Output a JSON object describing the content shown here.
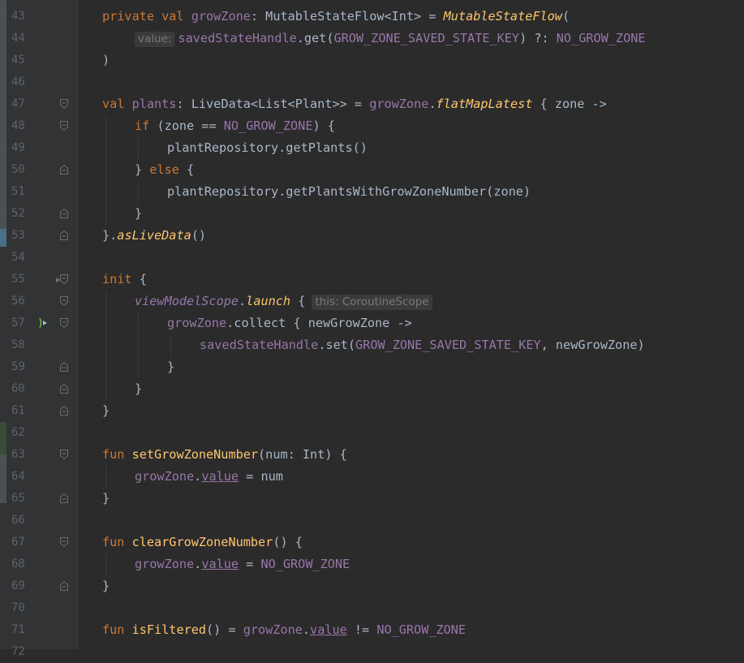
{
  "editor": {
    "language": "kotlin",
    "first_line": 43,
    "lines": [
      {
        "num": "43",
        "indent": 0,
        "tokens": [
          {
            "t": "private val ",
            "c": "kw"
          },
          {
            "t": "growZone",
            "c": "prop"
          },
          {
            "t": ": MutableStateFlow<Int> = ",
            "c": ""
          },
          {
            "t": "MutableStateFlow",
            "c": "top-fn"
          },
          {
            "t": "(",
            "c": ""
          }
        ],
        "fold": "none"
      },
      {
        "num": "44",
        "indent": 1,
        "tokens": [
          {
            "t": "value:",
            "c": "hint"
          },
          {
            "t": "savedStateHandle",
            "c": "prop"
          },
          {
            "t": ".get(",
            "c": ""
          },
          {
            "t": "GROW_ZONE_SAVED_STATE_KEY",
            "c": "prop"
          },
          {
            "t": ") ?: ",
            "c": ""
          },
          {
            "t": "NO_GROW_ZONE",
            "c": "prop"
          }
        ],
        "fold": "none"
      },
      {
        "num": "45",
        "indent": 0,
        "tokens": [
          {
            "t": ")",
            "c": ""
          }
        ],
        "fold": "none"
      },
      {
        "num": "46",
        "indent": 0,
        "tokens": [],
        "fold": "none"
      },
      {
        "num": "47",
        "indent": 0,
        "tokens": [
          {
            "t": "val ",
            "c": "kw"
          },
          {
            "t": "plants",
            "c": "prop"
          },
          {
            "t": ": LiveData<List<Plant>> = ",
            "c": ""
          },
          {
            "t": "growZone",
            "c": "prop"
          },
          {
            "t": ".",
            "c": ""
          },
          {
            "t": "flatMapLatest",
            "c": "ext"
          },
          {
            "t": " { zone ->",
            "c": ""
          }
        ],
        "fold": "open"
      },
      {
        "num": "48",
        "indent": 1,
        "tokens": [
          {
            "t": "if ",
            "c": "kw"
          },
          {
            "t": "(zone == ",
            "c": ""
          },
          {
            "t": "NO_GROW_ZONE",
            "c": "prop"
          },
          {
            "t": ") {",
            "c": ""
          }
        ],
        "fold": "open"
      },
      {
        "num": "49",
        "indent": 2,
        "tokens": [
          {
            "t": "plantRepository.getPlants()",
            "c": ""
          }
        ],
        "fold": "none"
      },
      {
        "num": "50",
        "indent": 1,
        "tokens": [
          {
            "t": "} ",
            "c": ""
          },
          {
            "t": "else ",
            "c": "kw"
          },
          {
            "t": "{",
            "c": ""
          }
        ],
        "fold": "close"
      },
      {
        "num": "51",
        "indent": 2,
        "tokens": [
          {
            "t": "plantRepository.getPlantsWithGrowZoneNumber(zone)",
            "c": ""
          }
        ],
        "fold": "none"
      },
      {
        "num": "52",
        "indent": 1,
        "tokens": [
          {
            "t": "}",
            "c": ""
          }
        ],
        "fold": "close"
      },
      {
        "num": "53",
        "indent": 0,
        "tokens": [
          {
            "t": "}.",
            "c": ""
          },
          {
            "t": "asLiveData",
            "c": "ext"
          },
          {
            "t": "()",
            "c": ""
          }
        ],
        "fold": "close"
      },
      {
        "num": "54",
        "indent": 0,
        "tokens": [],
        "fold": "none"
      },
      {
        "num": "55",
        "indent": 0,
        "tokens": [
          {
            "t": "init ",
            "c": "kw"
          },
          {
            "t": "{",
            "c": ""
          }
        ],
        "fold": "open"
      },
      {
        "num": "56",
        "indent": 1,
        "tokens": [
          {
            "t": "viewModelScope",
            "c": "prop ital"
          },
          {
            "t": ".",
            "c": ""
          },
          {
            "t": "launch",
            "c": "ext"
          },
          {
            "t": " {",
            "c": ""
          },
          {
            "t": "this: CoroutineScope",
            "c": "hint hint-after"
          }
        ],
        "fold": "open"
      },
      {
        "num": "57",
        "indent": 2,
        "tokens": [
          {
            "t": "growZone",
            "c": "prop"
          },
          {
            "t": ".collect { newGrowZone ->",
            "c": ""
          }
        ],
        "fold": "open"
      },
      {
        "num": "58",
        "indent": 3,
        "tokens": [
          {
            "t": "savedStateHandle",
            "c": "prop"
          },
          {
            "t": ".set(",
            "c": ""
          },
          {
            "t": "GROW_ZONE_SAVED_STATE_KEY",
            "c": "prop"
          },
          {
            "t": ", newGrowZone)",
            "c": ""
          }
        ],
        "fold": "none"
      },
      {
        "num": "59",
        "indent": 2,
        "tokens": [
          {
            "t": "}",
            "c": ""
          }
        ],
        "fold": "close"
      },
      {
        "num": "60",
        "indent": 1,
        "tokens": [
          {
            "t": "}",
            "c": ""
          }
        ],
        "fold": "close"
      },
      {
        "num": "61",
        "indent": 0,
        "tokens": [
          {
            "t": "}",
            "c": ""
          }
        ],
        "fold": "close"
      },
      {
        "num": "62",
        "indent": 0,
        "tokens": [],
        "fold": "none"
      },
      {
        "num": "63",
        "indent": 0,
        "tokens": [
          {
            "t": "fun ",
            "c": "kw"
          },
          {
            "t": "setGrowZoneNumber",
            "c": "fn"
          },
          {
            "t": "(num: Int) {",
            "c": ""
          }
        ],
        "fold": "open"
      },
      {
        "num": "64",
        "indent": 1,
        "tokens": [
          {
            "t": "growZone",
            "c": "prop"
          },
          {
            "t": ".",
            "c": ""
          },
          {
            "t": "value",
            "c": "prop under"
          },
          {
            "t": " = num",
            "c": ""
          }
        ],
        "fold": "none"
      },
      {
        "num": "65",
        "indent": 0,
        "tokens": [
          {
            "t": "}",
            "c": ""
          }
        ],
        "fold": "close"
      },
      {
        "num": "66",
        "indent": 0,
        "tokens": [],
        "fold": "none"
      },
      {
        "num": "67",
        "indent": 0,
        "tokens": [
          {
            "t": "fun ",
            "c": "kw"
          },
          {
            "t": "clearGrowZoneNumber",
            "c": "fn"
          },
          {
            "t": "() {",
            "c": ""
          }
        ],
        "fold": "open"
      },
      {
        "num": "68",
        "indent": 1,
        "tokens": [
          {
            "t": "growZone",
            "c": "prop"
          },
          {
            "t": ".",
            "c": ""
          },
          {
            "t": "value",
            "c": "prop under"
          },
          {
            "t": " = ",
            "c": ""
          },
          {
            "t": "NO_GROW_ZONE",
            "c": "prop"
          }
        ],
        "fold": "none"
      },
      {
        "num": "69",
        "indent": 0,
        "tokens": [
          {
            "t": "}",
            "c": ""
          }
        ],
        "fold": "close"
      },
      {
        "num": "70",
        "indent": 0,
        "tokens": [],
        "fold": "none"
      },
      {
        "num": "71",
        "indent": 0,
        "tokens": [
          {
            "t": "fun ",
            "c": "kw"
          },
          {
            "t": "isFiltered",
            "c": "fn"
          },
          {
            "t": "() = ",
            "c": ""
          },
          {
            "t": "growZone",
            "c": "prop"
          },
          {
            "t": ".",
            "c": ""
          },
          {
            "t": "value",
            "c": "prop under"
          },
          {
            "t": " != ",
            "c": ""
          },
          {
            "t": "NO_GROW_ZONE",
            "c": "prop"
          }
        ],
        "fold": "none"
      },
      {
        "num": "72",
        "indent": 0,
        "tokens": [],
        "fold": "none"
      }
    ]
  },
  "gutter": {
    "run_gutter_icon_line": "57",
    "run_gutter_icon": "coroutine-suspend-call-icon",
    "breakpoint_arrow_line": "55",
    "breakpoint_arrow_icon": "collapse-arrow-icon"
  },
  "colors": {
    "background": "#2b2b2b",
    "gutter": "#313335",
    "keyword": "#cc7832",
    "property": "#9876aa",
    "function": "#ffc66d",
    "text": "#a9b7c6",
    "line_number": "#606366",
    "hint_bg": "#3b3b3b",
    "hint_text": "#787878",
    "caret_line_marker": "#4a6f88",
    "change_bar_gray": "#4c5052",
    "change_bar_green": "#384c38"
  }
}
